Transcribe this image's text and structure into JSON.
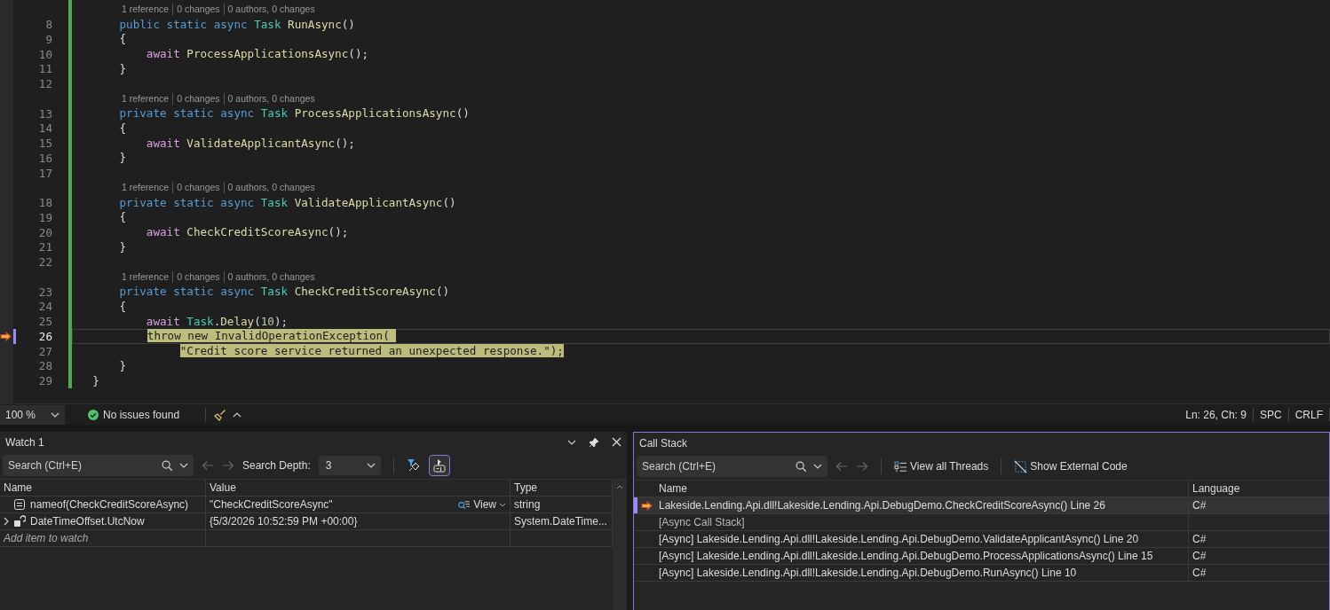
{
  "editor": {
    "lines": [
      {
        "kind": "lens",
        "parts": [
          "1 reference",
          "0 changes",
          "0 authors, 0 changes"
        ]
      },
      {
        "kind": "code",
        "number": "8",
        "current": false,
        "tokens": [
          {
            "text": "      public static async ",
            "kind": "keyword"
          },
          {
            "text": "Task",
            "kind": "type"
          },
          {
            "text": " RunAsync",
            "kind": "method"
          },
          {
            "text": "()",
            "kind": "plain"
          }
        ]
      },
      {
        "kind": "code",
        "number": "9",
        "current": false,
        "tokens": [
          {
            "text": "      {",
            "kind": "plain"
          }
        ]
      },
      {
        "kind": "code",
        "number": "10",
        "current": false,
        "tokens": [
          {
            "text": "          await",
            "kind": "control"
          },
          {
            "text": " ProcessApplicationsAsync",
            "kind": "method"
          },
          {
            "text": "();",
            "kind": "plain"
          }
        ]
      },
      {
        "kind": "code",
        "number": "11",
        "current": false,
        "tokens": [
          {
            "text": "      }",
            "kind": "plain"
          }
        ]
      },
      {
        "kind": "code",
        "number": "12",
        "current": false
      },
      {
        "kind": "lens",
        "parts": [
          "1 reference",
          "0 changes",
          "0 authors, 0 changes"
        ]
      },
      {
        "kind": "code",
        "number": "13",
        "current": false,
        "tokens": [
          {
            "text": "      private static async ",
            "kind": "keyword"
          },
          {
            "text": "Task",
            "kind": "type"
          },
          {
            "text": " ProcessApplicationsAsync",
            "kind": "method"
          },
          {
            "text": "()",
            "kind": "plain"
          }
        ]
      },
      {
        "kind": "code",
        "number": "14",
        "current": false,
        "tokens": [
          {
            "text": "      {",
            "kind": "plain"
          }
        ]
      },
      {
        "kind": "code",
        "number": "15",
        "current": false,
        "tokens": [
          {
            "text": "          await",
            "kind": "control"
          },
          {
            "text": " ValidateApplicantAsync",
            "kind": "method"
          },
          {
            "text": "();",
            "kind": "plain"
          }
        ]
      },
      {
        "kind": "code",
        "number": "16",
        "current": false,
        "tokens": [
          {
            "text": "      }",
            "kind": "plain"
          }
        ]
      },
      {
        "kind": "code",
        "number": "17",
        "current": false
      },
      {
        "kind": "lens",
        "parts": [
          "1 reference",
          "0 changes",
          "0 authors, 0 changes"
        ]
      },
      {
        "kind": "code",
        "number": "18",
        "current": false,
        "tokens": [
          {
            "text": "      private static async ",
            "kind": "keyword"
          },
          {
            "text": "Task",
            "kind": "type"
          },
          {
            "text": " ValidateApplicantAsync",
            "kind": "method"
          },
          {
            "text": "()",
            "kind": "plain"
          }
        ]
      },
      {
        "kind": "code",
        "number": "19",
        "current": false,
        "tokens": [
          {
            "text": "      {",
            "kind": "plain"
          }
        ]
      },
      {
        "kind": "code",
        "number": "20",
        "current": false,
        "tokens": [
          {
            "text": "          await",
            "kind": "control"
          },
          {
            "text": " CheckCreditScoreAsync",
            "kind": "method"
          },
          {
            "text": "();",
            "kind": "plain"
          }
        ]
      },
      {
        "kind": "code",
        "number": "21",
        "current": false,
        "tokens": [
          {
            "text": "      }",
            "kind": "plain"
          }
        ]
      },
      {
        "kind": "code",
        "number": "22",
        "current": false
      },
      {
        "kind": "lens",
        "parts": [
          "1 reference",
          "0 changes",
          "0 authors, 0 changes"
        ]
      },
      {
        "kind": "code",
        "number": "23",
        "current": false,
        "tokens": [
          {
            "text": "      private static async ",
            "kind": "keyword"
          },
          {
            "text": "Task",
            "kind": "type"
          },
          {
            "text": " CheckCreditScoreAsync",
            "kind": "method"
          },
          {
            "text": "()",
            "kind": "plain"
          }
        ]
      },
      {
        "kind": "code",
        "number": "24",
        "current": false,
        "tokens": [
          {
            "text": "      {",
            "kind": "plain"
          }
        ]
      },
      {
        "kind": "code",
        "number": "25",
        "current": false,
        "tokens": [
          {
            "text": "          await",
            "kind": "control"
          },
          {
            "text": " Task",
            "kind": "type"
          },
          {
            "text": ".",
            "kind": "plain"
          },
          {
            "text": "Delay",
            "kind": "method"
          },
          {
            "text": "(",
            "kind": "plain"
          },
          {
            "text": "10",
            "kind": "number"
          },
          {
            "text": ");",
            "kind": "plain"
          }
        ]
      },
      {
        "kind": "code",
        "number": "26",
        "current": true,
        "tokens": [
          {
            "text": "          throw new InvalidOperationException( ",
            "kind": "highlight"
          }
        ]
      },
      {
        "kind": "code",
        "number": "27",
        "current": false,
        "tokens": [
          {
            "text": "               \"Credit score service returned an unexpected response.\");",
            "kind": "highlight"
          }
        ]
      },
      {
        "kind": "code",
        "number": "28",
        "current": false,
        "tokens": [
          {
            "text": "      }",
            "kind": "plain"
          }
        ]
      },
      {
        "kind": "code",
        "number": "29",
        "current": false,
        "tokens": [
          {
            "text": "  }",
            "kind": "plain"
          }
        ]
      }
    ]
  },
  "status_bar": {
    "zoom": "100 %",
    "issues": "No issues found",
    "position": "Ln: 26, Ch: 9",
    "indentation": "SPC",
    "line_ending": "CRLF"
  },
  "watch": {
    "title": "Watch 1",
    "search": {
      "placeholder": "Search (Ctrl+E)"
    },
    "depth_label": "Search Depth:",
    "depth": "3",
    "raw_view": {
      "selected": true
    },
    "columns": [
      "Name",
      "Value",
      "Type"
    ],
    "rows": [
      {
        "kind": "property",
        "name": "nameof(CheckCreditScoreAsync)",
        "value": "\"CheckCreditScoreAsync\"",
        "view": "View",
        "type": "string",
        "expandable": false
      },
      {
        "kind": "struct",
        "name": "DateTimeOffset.UtcNow",
        "value": "{5/3/2026 10:52:59 PM +00:00}",
        "type": "System.DateTime...",
        "expandable": true
      }
    ],
    "add_placeholder": "Add item to watch"
  },
  "call_stack": {
    "title": "Call Stack",
    "search": {
      "placeholder": "Search (Ctrl+E)"
    },
    "buttons": [
      {
        "kind": "threads",
        "label": "View all Threads"
      },
      {
        "kind": "external",
        "label": "Show External Code"
      }
    ],
    "columns": [
      "Name",
      "Language"
    ],
    "frames": [
      {
        "kind": "frame",
        "name": "Lakeside.Lending.Api.dll!Lakeside.Lending.Api.DebugDemo.CheckCreditScoreAsync() Line 26",
        "language": "C#",
        "current": true
      },
      {
        "kind": "label",
        "name": "[Async Call Stack]",
        "current": false
      },
      {
        "kind": "frame",
        "name": "[Async] Lakeside.Lending.Api.dll!Lakeside.Lending.Api.DebugDemo.ValidateApplicantAsync() Line 20",
        "language": "C#",
        "current": false
      },
      {
        "kind": "frame",
        "name": "[Async] Lakeside.Lending.Api.dll!Lakeside.Lending.Api.DebugDemo.ProcessApplicationsAsync() Line 15",
        "language": "C#",
        "current": false
      },
      {
        "kind": "frame",
        "name": "[Async] Lakeside.Lending.Api.dll!Lakeside.Lending.Api.DebugDemo.RunAsync() Line 10",
        "language": "C#",
        "current": false
      }
    ]
  }
}
